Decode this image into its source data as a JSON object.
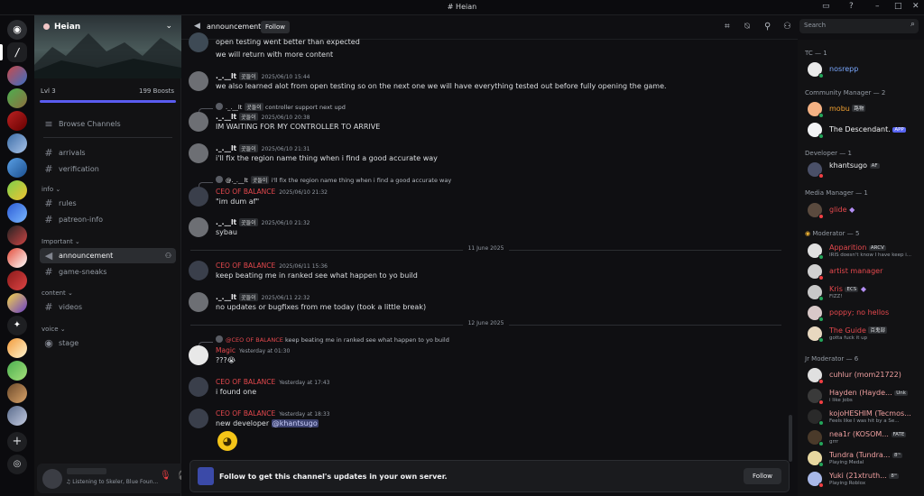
{
  "window": {
    "title": "Heian"
  },
  "server": {
    "name": "Heian",
    "level": "Lvl 3",
    "boosts": "199 Boosts"
  },
  "sidebar": {
    "browse": "Browse Channels",
    "channels_top": [
      {
        "label": "arrivals"
      },
      {
        "label": "verification"
      }
    ],
    "info_cat": "info",
    "info": [
      {
        "label": "rules"
      },
      {
        "label": "patreon-info"
      }
    ],
    "important_cat": "Important",
    "important": [
      {
        "label": "announcement"
      },
      {
        "label": "game-sneaks"
      }
    ],
    "content_cat": "content",
    "content": [
      {
        "label": "videos"
      }
    ],
    "voice_cat": "voice",
    "voice": [
      {
        "label": "stage"
      }
    ]
  },
  "userbar": {
    "status": "Listening to Skeler, Blue Foun..."
  },
  "header": {
    "channel": "announcement",
    "follow": "Follow"
  },
  "search": {
    "placeholder": "Search"
  },
  "chat": {
    "m0_l1": "open testing went better than expected",
    "m0_l2": "we will return with more content",
    "m1_user": "._.__lt",
    "m1_tag": "곳들이",
    "m1_time": "2025/06/10 15:44",
    "m1_text": "we also learned alot from open testing so on the next one we will have everything tested out before fully opening the game.",
    "m2_reply_user": "._.__lt",
    "m2_reply_tag": "곳들이",
    "m2_reply_text": "controller support next upd",
    "m2_user": "._.__lt",
    "m2_tag": "곳들이",
    "m2_time": "2025/06/10 20:38",
    "m2_text": "IM WAITING FOR MY CONTROLLER TO ARRIVE",
    "m3_user": "._.__lt",
    "m3_tag": "곳들이",
    "m3_time": "2025/06/10 21:31",
    "m3_text": "i'll fix the region name thing when i find a good accurate way",
    "m4_reply_user": "@._.__lt",
    "m4_reply_tag": "곳들이",
    "m4_reply_text": "i'll fix the region name thing when i find a good accurate way",
    "m4_user": "CEO OF BALANCE",
    "m4_time": "2025/06/10 21:32",
    "m4_text": "\"im dum af\"",
    "m5_user": "._.__lt",
    "m5_tag": "곳들이",
    "m5_time": "2025/06/10 21:32",
    "m5_text": "sybau",
    "date1": "11 June 2025",
    "m6_user": "CEO OF BALANCE",
    "m6_time": "2025/06/11 15:36",
    "m6_text": "keep beating me in ranked see what happen to yo build",
    "m7_user": "._.__lt",
    "m7_tag": "곳들이",
    "m7_time": "2025/06/11 22:32",
    "m7_text": "no updates or bugfixes from me today (took a little break)",
    "date2": "12 June 2025",
    "m8_reply_user": "@CEO OF BALANCE",
    "m8_reply_text": "keep beating me in ranked see what happen to yo build",
    "m8_user": "Magic",
    "m8_time": "Yesterday at 01:30",
    "m8_text": "???😭",
    "m9_user": "CEO OF BALANCE",
    "m9_time": "Yesterday at 17:43",
    "m9_text": "i found one",
    "m10_user": "CEO OF BALANCE",
    "m10_time": "Yesterday at 18:33",
    "m10_text": "new developer ",
    "m10_mention": "@khantsugo",
    "follow_text": "Follow to get this channel's updates in your own server.",
    "follow_btn": "Follow"
  },
  "members": {
    "tc": "TC — 1",
    "tc1": "nosrepp",
    "cm": "Community Manager — 2",
    "cm1": "mobu",
    "cm1_tag": "路物",
    "cm2": "The Descendant.",
    "cm2_app": "APP",
    "dev": "Developer — 1",
    "dev1": "khantsugo",
    "dev1_tag": "AF",
    "media": "Media Manager — 1",
    "media1": "glide",
    "mod": "Moderator — 5",
    "mod1": "Apparition",
    "mod1_tag": "ARCV",
    "mod1_status": "IRIS doesn't know I have keep i...",
    "mod2": "artist manager",
    "mod3": "Kris",
    "mod3_tag": "ECS",
    "mod3_status": "FIZZ!",
    "mod4": "poppy; no hellos",
    "mod5": "The Guide",
    "mod5_tag": "百鬼部",
    "mod5_status": "gotta fuck it up",
    "jr": "Jr Moderator — 6",
    "jr1": "cuhlur (mom21722)",
    "jr2": "Hayden (Hayde...",
    "jr2_tag": "Unk",
    "jr2_status": "i like jobs",
    "jr3": "kojoHESHIM (Tecmos...",
    "jr3_status": "Feels like I was hit by a Se...",
    "jr4": "nea1r (KOSOM...",
    "jr4_tag": "FATE",
    "jr4_status": "grrr",
    "jr5": "Tundra (Tundra...",
    "jr5_tag": "8ᵐ",
    "jr5_status": "Playing Medal",
    "jr6": "Yuki (21xtruth...",
    "jr6_tag": "8ᵐ",
    "jr6_status": "Playing Roblox"
  },
  "colors": {
    "ceo": "#e5484d",
    "accent": "#5865f2",
    "online": "#23a55a",
    "dnd": "#f23f43"
  }
}
